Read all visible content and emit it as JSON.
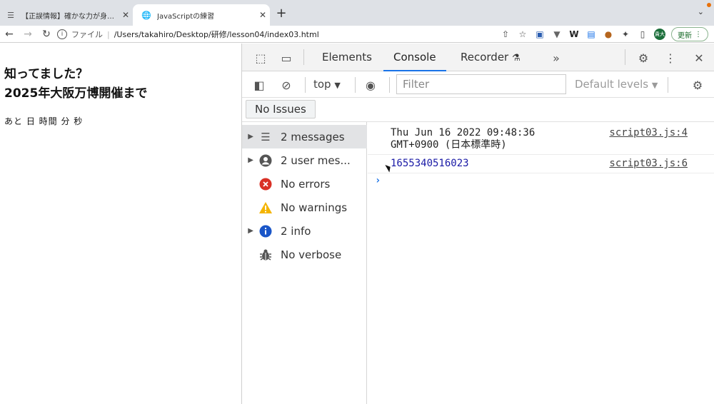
{
  "browser": {
    "tabs": [
      {
        "title": "【正誤情報】確かな力が身につく"
      },
      {
        "title": "JavaScriptの練習"
      }
    ],
    "address": {
      "scheme_label": "ファイル",
      "url": "/Users/takahiro/Desktop/研修/lesson04/index03.html"
    },
    "profile_initials": "貴大",
    "update_label": "更新"
  },
  "page": {
    "heading_line1": "知ってました？",
    "heading_line2": "2025年大阪万博開催まで",
    "countdown": "あと 日 時間 分 秒"
  },
  "devtools": {
    "tabs": [
      "Elements",
      "Console",
      "Recorder"
    ],
    "active_tab": "Console",
    "context": "top",
    "filter_placeholder": "Filter",
    "levels": "Default levels",
    "issues": "No Issues",
    "sidebar": [
      {
        "label": "2 messages",
        "icon": "list-icon",
        "expandable": true
      },
      {
        "label": "2 user mes...",
        "icon": "user-icon",
        "expandable": true
      },
      {
        "label": "No errors",
        "icon": "error-icon",
        "expandable": false
      },
      {
        "label": "No warnings",
        "icon": "warning-icon",
        "expandable": false
      },
      {
        "label": "2 info",
        "icon": "info-icon",
        "expandable": true
      },
      {
        "label": "No verbose",
        "icon": "bug-icon",
        "expandable": false
      }
    ],
    "messages": [
      {
        "line1": "Thu Jun 16 2022 09:48:36",
        "line2": "GMT+0900 (日本標準時)",
        "source": "script03.js:4"
      },
      {
        "line1": "1655340516023",
        "source": "script03.js:6"
      }
    ]
  },
  "colors": {
    "accent": "#1a73e8",
    "error": "#d93025",
    "warning": "#f4b400",
    "info": "#1a56c8"
  }
}
